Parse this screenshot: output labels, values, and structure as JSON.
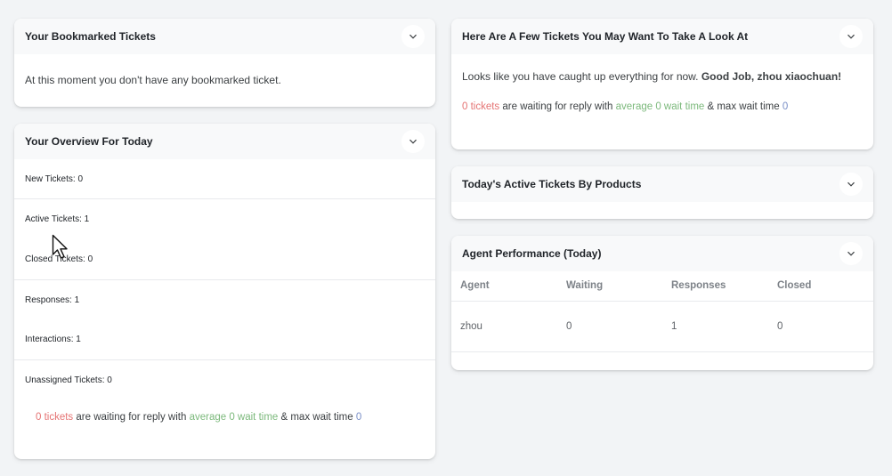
{
  "bookmarked": {
    "title": "Your Bookmarked Tickets",
    "message": "At this moment you don't have any bookmarked ticket."
  },
  "overview": {
    "title": "Your Overview For Today",
    "new_tickets": "New Tickets: 0",
    "active_tickets": "Active Tickets: 1",
    "closed_tickets": "Closed Tickets: 0",
    "responses": "Responses: 1",
    "interactions": "Interactions: 1",
    "unassigned": "Unassigned Tickets: 0",
    "waiting": {
      "tickets": "0 tickets",
      "mid": " are waiting for reply with ",
      "average": "average 0 wait time",
      "amp": " & max wait time ",
      "max": "0"
    }
  },
  "suggest": {
    "title": "Here Are A Few Tickets You May Want To Take A Look At",
    "caught_up": "Looks like you have caught up everything for now. ",
    "good_job": "Good Job, zhou xiaochuan!",
    "waiting": {
      "tickets": "0 tickets",
      "mid": " are waiting for reply with ",
      "average": "average 0 wait time",
      "amp": " & max wait time ",
      "max": "0"
    }
  },
  "products": {
    "title": "Today's Active Tickets By Products"
  },
  "performance": {
    "title": "Agent Performance (Today)",
    "columns": [
      "Agent",
      "Waiting",
      "Responses",
      "Closed"
    ],
    "rows": [
      [
        "zhou",
        "0",
        "1",
        "0"
      ]
    ]
  },
  "icons": {
    "toggle": "chevron-down-icon",
    "cursor": "mouse-pointer-icon"
  },
  "colors": {
    "red": "#e57373",
    "green": "#7cb97c",
    "blue": "#7a8fc7"
  }
}
